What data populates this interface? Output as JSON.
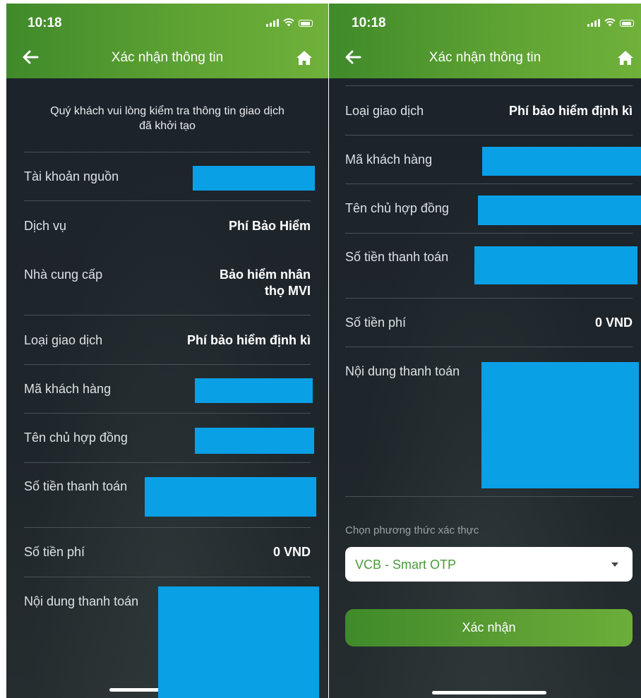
{
  "status_bar": {
    "time": "10:18"
  },
  "header": {
    "title": "Xác nhận thông tin"
  },
  "left": {
    "intro": "Quý khách vui lòng kiểm tra thông tin giao dịch\nđã khởi tạo",
    "labels": {
      "source_account": "Tài khoản nguồn",
      "service": "Dịch vụ",
      "provider": "Nhà cung cấp",
      "transaction_type": "Loại giao dịch",
      "customer_code": "Mã khách hàng",
      "contract_holder": "Tên chủ hợp đồng",
      "payment_amount": "Số tiền thanh toán",
      "fee_amount": "Số tiền phí",
      "payment_content": "Nội dung thanh toán"
    },
    "values": {
      "service": "Phí Bảo Hiểm",
      "provider_line1": "Bảo hiểm nhân",
      "provider_line2": "thọ MVI",
      "transaction_type": "Phí bảo hiểm định kì",
      "fee_amount": "0 VND"
    }
  },
  "right": {
    "labels": {
      "transaction_type": "Loại giao dịch",
      "customer_code": "Mã khách hàng",
      "contract_holder": "Tên chủ hợp đồng",
      "payment_amount": "Số tiền thanh toán",
      "fee_amount": "Số tiền phí",
      "payment_content": "Nội dung thanh toán"
    },
    "values": {
      "transaction_type": "Phí bảo hiểm định kì",
      "fee_amount": "0 VND"
    },
    "auth_method": {
      "label": "Chọn phương thức xác thực",
      "selected": "VCB - Smart OTP"
    },
    "confirm_button": "Xác nhận"
  },
  "colors": {
    "header_green": "#5ea233",
    "background": "#1c232a",
    "redaction": "#0aa0e6",
    "select_text": "#4a9a3b"
  },
  "icons": [
    "back-arrow-icon",
    "home-icon",
    "signal-icon",
    "wifi-icon",
    "battery-icon",
    "chevron-down-icon"
  ]
}
